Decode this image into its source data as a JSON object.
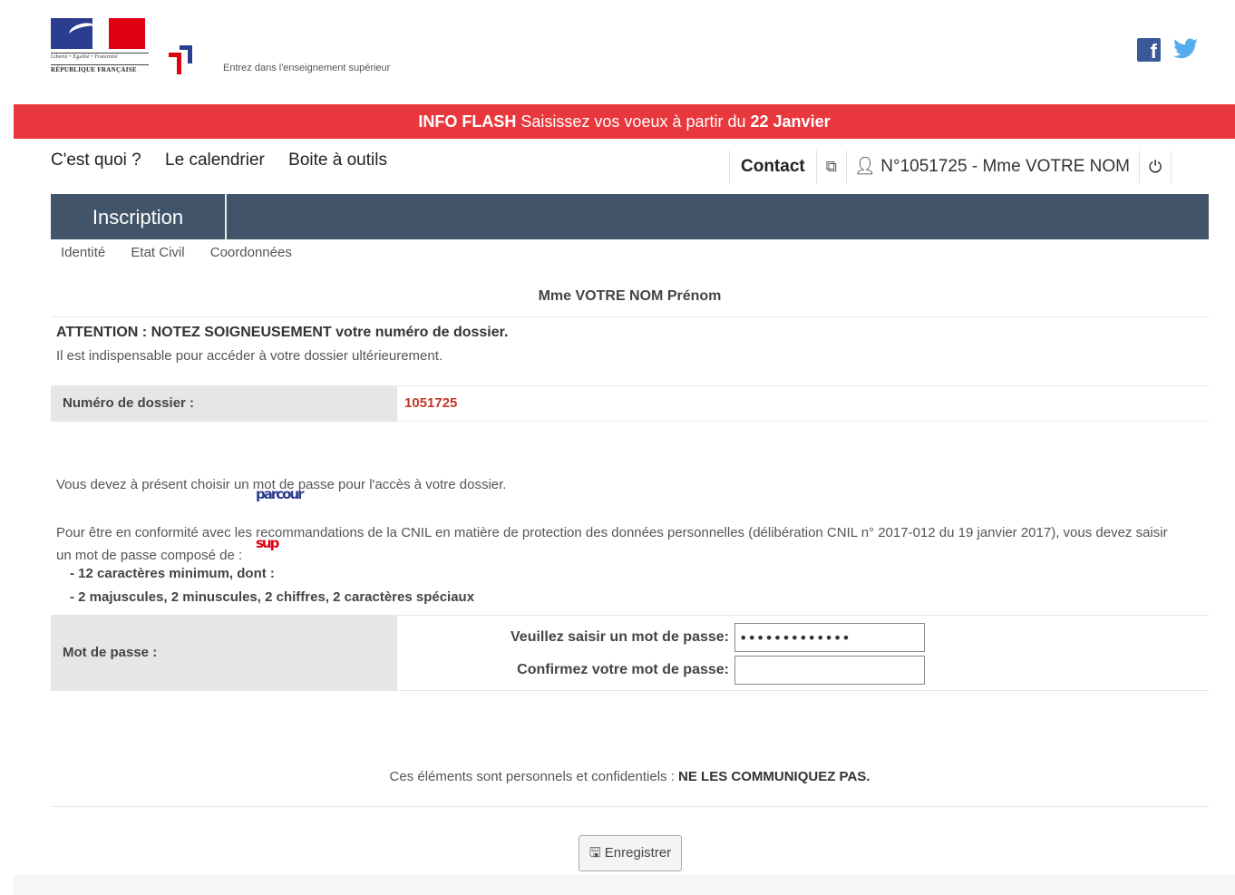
{
  "header": {
    "rf_motto": "Liberté • Égalité • Fraternité",
    "rf_name": "RÉPUBLIQUE FRANÇAISE",
    "logo_part1": "parcour",
    "logo_part2": "sup",
    "tagline": "Entrez dans l'enseignement supérieur",
    "social": {
      "facebook": "facebook-icon",
      "twitter": "twitter-icon"
    }
  },
  "flash": {
    "label": "INFO FLASH",
    "message": " Saisissez vos voeux à partir du ",
    "date": "22 Janvier"
  },
  "topnav": {
    "items": [
      "C'est quoi ?",
      "Le calendrier",
      "Boite à outils"
    ]
  },
  "usernav": {
    "contact": "Contact",
    "user": "N°1051725 - Mme VOTRE NOM"
  },
  "tabs": {
    "active": "Inscription",
    "subtabs": [
      "Identité",
      "Etat Civil",
      "Coordonnées"
    ]
  },
  "content": {
    "name": "Mme VOTRE NOM Prénom",
    "attention": "ATTENTION : NOTEZ SOIGNEUSEMENT votre numéro de dossier.",
    "indispensable": "Il est indispensable pour accéder à votre dossier ultérieurement.",
    "dossier_label": "Numéro de dossier :",
    "dossier_value": "1051725",
    "choose_password": "Vous devez à présent choisir un mot de passe pour l'accès à votre dossier.",
    "cnil": "Pour être en conformité avec les recommandations de la CNIL en matière de protection des données personnelles (délibération CNIL n° 2017-012 du 19 janvier 2017), vous devez saisir un mot de passe composé de :",
    "rule1": "- 12 caractères minimum, dont :",
    "rule2": "- 2 majuscules, 2 minuscules, 2 chiffres, 2 caractères spéciaux",
    "password_label": "Mot de passe :",
    "enter_password_label": "Veuillez saisir un mot de passe:",
    "enter_password_value": "•••••••••••••",
    "confirm_password_label": "Confirmez votre mot de passe:",
    "confirm_password_value": "",
    "confidential_text": "Ces éléments sont personnels et confidentiels : ",
    "confidential_bold": "NE LES COMMUNIQUEZ PAS.",
    "save_label": "Enregistrer"
  }
}
